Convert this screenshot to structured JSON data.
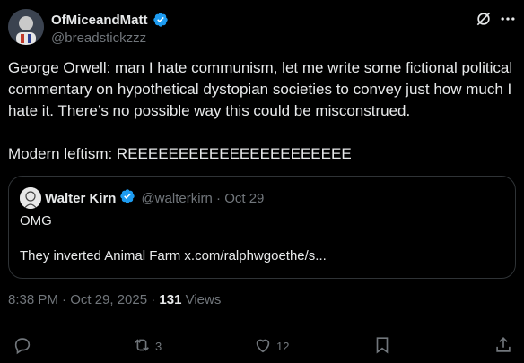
{
  "author": {
    "display_name": "OfMiceandMatt",
    "handle": "@breadstickzzz",
    "verified": true
  },
  "icons": {
    "grok": "grok-icon",
    "more": "more-icon",
    "reply": "reply-icon",
    "retweet": "retweet-icon",
    "like": "like-icon",
    "bookmark": "bookmark-icon",
    "share": "share-icon"
  },
  "tweet": {
    "text": "George Orwell: man I hate communism, let me write some fictional political commentary on hypothetical dystopian societies to convey just how much I hate it. There’s no possible way this could be misconstrued.\n\nModern leftism: REEEEEEEEEEEEEEEEEEEEEE"
  },
  "quoted": {
    "display_name": "Walter Kirn",
    "meta": "@walterkirn · Oct 29",
    "line1": "OMG",
    "line2": "They inverted Animal Farm x.com/ralphwgoethe/s..."
  },
  "timestamp": {
    "time": "8:38 PM · Oct 29, 2025 · ",
    "views_count": "131",
    "views_label": " Views"
  },
  "actions": {
    "reply_count": "",
    "retweet_count": "3",
    "like_count": "12"
  },
  "colors": {
    "background": "#000000",
    "text": "#e7e9ea",
    "secondary": "#71767b",
    "border": "#2f3336",
    "verified": "#1d9bf0"
  }
}
